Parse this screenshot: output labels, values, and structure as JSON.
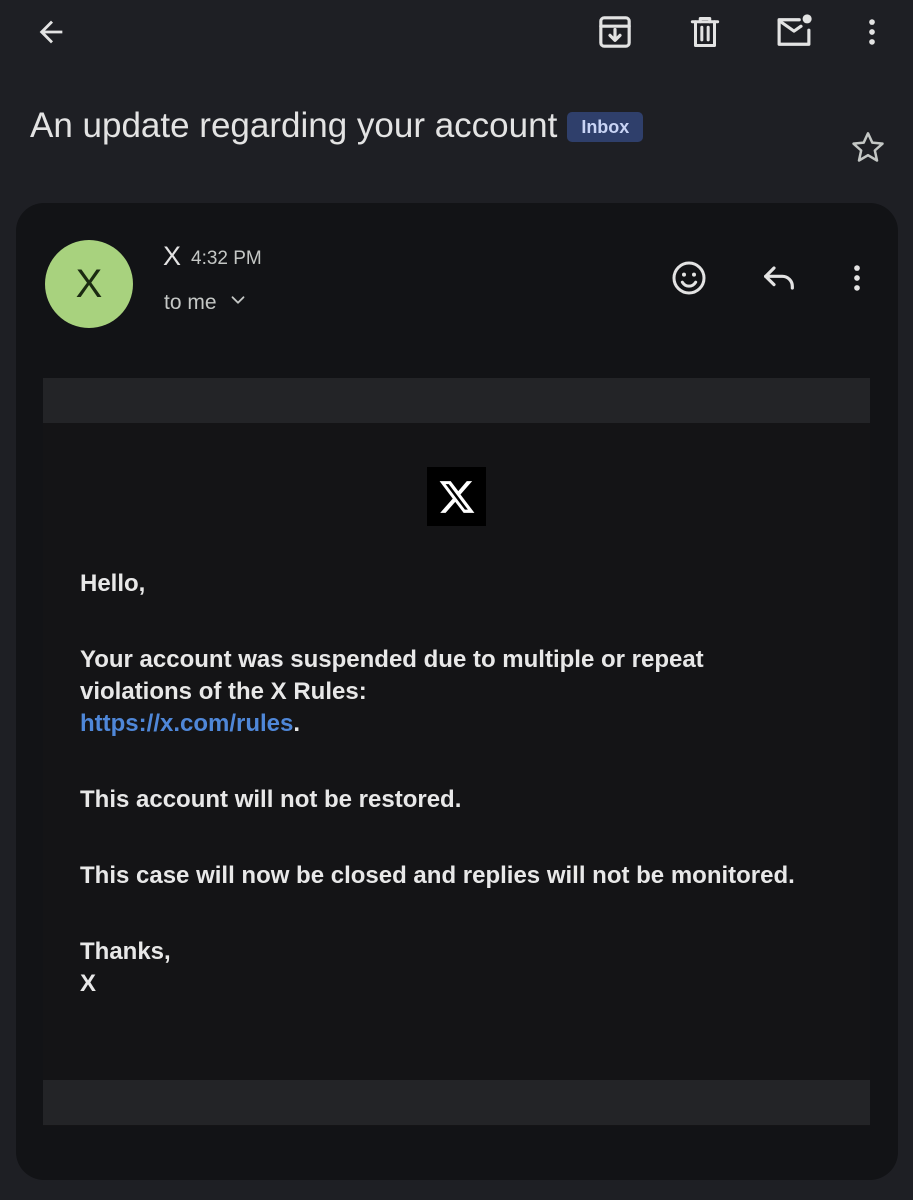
{
  "topbar": {
    "back_icon": "arrow-left-icon",
    "archive_icon": "archive-icon",
    "delete_icon": "trash-icon",
    "mark_unread_icon": "mail-unread-icon",
    "more_icon": "more-vert-icon"
  },
  "subject": {
    "title": "An update regarding your account",
    "label": "Inbox",
    "star_icon": "star-outline-icon"
  },
  "message": {
    "avatar_letter": "X",
    "avatar_color": "#a8d27e",
    "sender": "X",
    "time": "4:32 PM",
    "recipient": "to me",
    "actions": {
      "react_icon": "emoji-icon",
      "reply_icon": "reply-icon",
      "more_icon": "more-vert-icon"
    }
  },
  "email": {
    "logo": "x-logo",
    "greeting": "Hello,",
    "paragraph1_text": "Your account was suspended due to multiple or repeat violations of the X Rules:",
    "paragraph1_link": "https://x.com/rules",
    "paragraph1_end": ".",
    "paragraph2": "This account will not be restored.",
    "paragraph3": "This case will now be closed and replies will not be monitored.",
    "signoff": "Thanks,",
    "signature": "X"
  },
  "colors": {
    "background": "#1e1f24",
    "card": "#121316",
    "link": "#4f87d8",
    "label_chip": "#2f3f6b"
  }
}
